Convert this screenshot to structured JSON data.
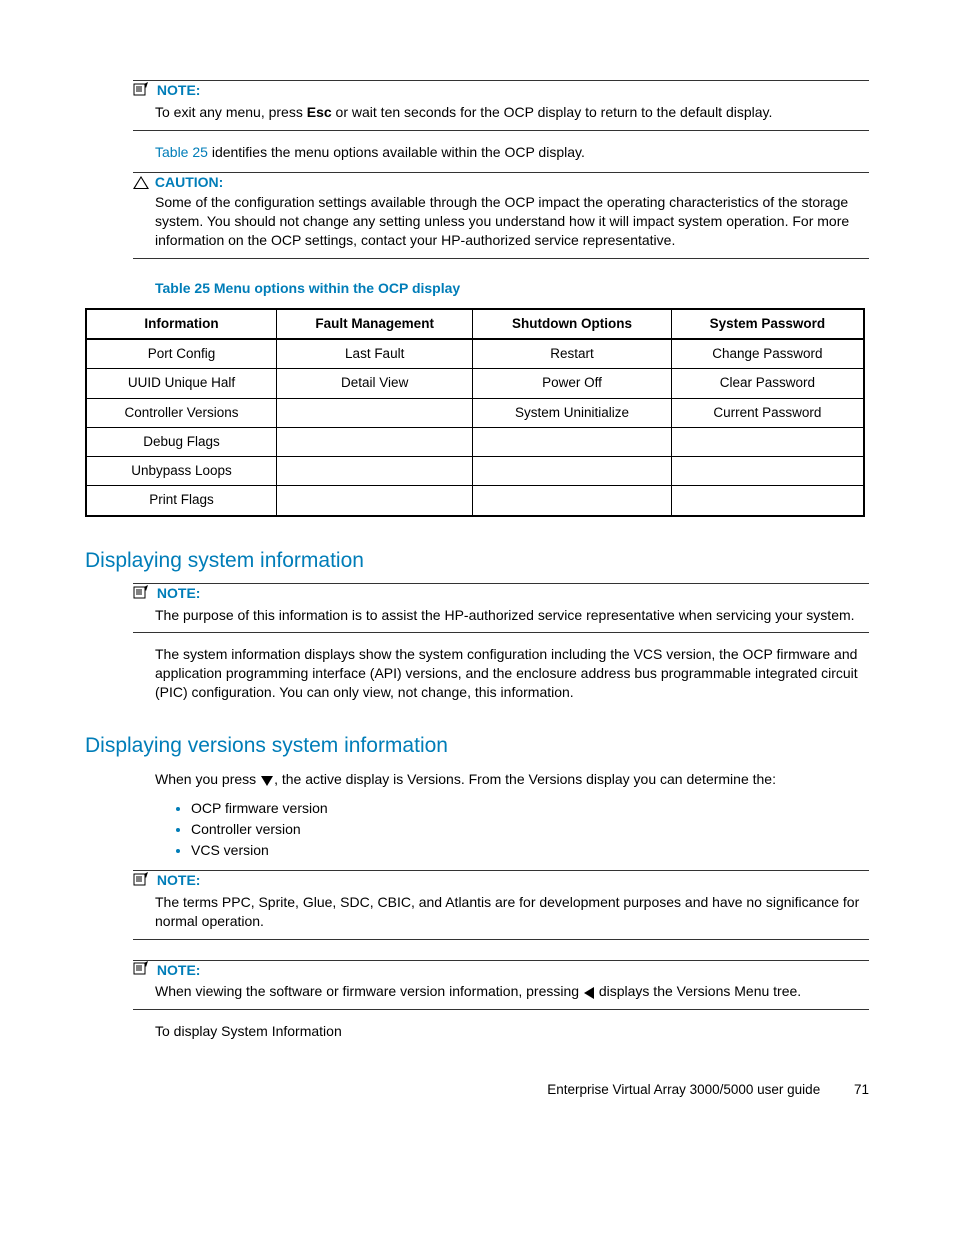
{
  "notes": {
    "n1_label": "NOTE:",
    "n1_body_a": "To exit any menu, press ",
    "n1_body_bold": "Esc",
    "n1_body_b": " or wait ten seconds for the OCP display to return to the default display."
  },
  "ref_para_a": "Table 25",
  "ref_para_b": " identifies the menu options available within the OCP display.",
  "caution": {
    "label": "CAUTION:",
    "body": "Some of the configuration settings available through the OCP impact the operating characteristics of the storage system. You should not change any setting unless you understand how it will impact system operation. For more information on the OCP settings, contact your HP-authorized service representative."
  },
  "table": {
    "title": "Table 25 Menu options within the OCP display",
    "headers": [
      "Information",
      "Fault Management",
      "Shutdown Options",
      "System Password"
    ],
    "rows": [
      [
        "Port Config",
        "Last Fault",
        "Restart",
        "Change Password"
      ],
      [
        "UUID Unique Half",
        "Detail View",
        "Power Off",
        "Clear Password"
      ],
      [
        "Controller Versions",
        "",
        "System Uninitialize",
        "Current Password"
      ],
      [
        "Debug Flags",
        "",
        "",
        ""
      ],
      [
        "Unbypass Loops",
        "",
        "",
        ""
      ],
      [
        "Print Flags",
        "",
        "",
        ""
      ]
    ]
  },
  "section1": {
    "title": "Displaying system information",
    "note_label": "NOTE:",
    "note_body": "The purpose of this information is to assist the HP-authorized service representative when servicing your system.",
    "para": "The system information displays show the system configuration including the VCS version, the OCP firmware and application programming interface (API) versions, and the enclosure address bus programmable integrated circuit (PIC) configuration. You can only view, not change, this information."
  },
  "section2": {
    "title": "Displaying versions system information",
    "intro_a": "When you press ",
    "intro_b": ", the active display is Versions. From the Versions display you can determine the:",
    "bullets": [
      "OCP firmware version",
      "Controller version",
      "VCS version"
    ],
    "note1_label": "NOTE:",
    "note1_body": "The terms PPC, Sprite, Glue, SDC, CBIC, and Atlantis are for development purposes and have no significance for normal operation.",
    "note2_label": "NOTE:",
    "note2_body_a": "When viewing the software or firmware version information, pressing ",
    "note2_body_b": " displays the Versions Menu tree.",
    "closing": "To display System Information"
  },
  "footer": {
    "text": "Enterprise Virtual Array 3000/5000 user guide",
    "page": "71"
  }
}
